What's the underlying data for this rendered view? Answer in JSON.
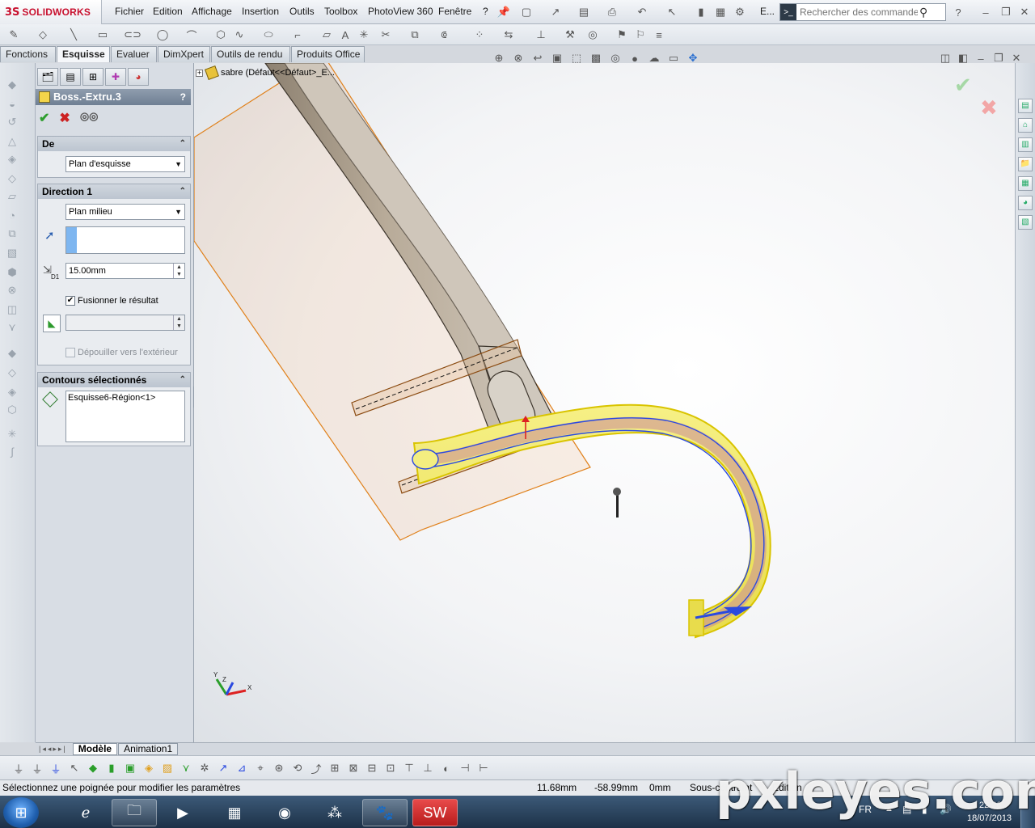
{
  "app": {
    "brand": "SOLIDWORKS",
    "brand_prefix": "3S"
  },
  "menu": {
    "items": [
      "Fichier",
      "Edition",
      "Affichage",
      "Insertion",
      "Outils",
      "Toolbox",
      "PhotoView 360",
      "Fenêtre",
      "?"
    ],
    "extra": "E..."
  },
  "search": {
    "placeholder": "Rechercher des commandes"
  },
  "command_tabs": [
    "Fonctions",
    "Esquisse",
    "Evaluer",
    "DimXpert",
    "Outils de rendu",
    "Produits Office"
  ],
  "active_tab": "Esquisse",
  "feature_tree": {
    "root_label": "sabre  (Défaut<<Défaut>_E..."
  },
  "property_manager": {
    "title": "Boss.-Extru.3",
    "help": "?",
    "groups": {
      "from": {
        "title": "De",
        "start_condition": "Plan d'esquisse"
      },
      "direction1": {
        "title": "Direction 1",
        "end_condition": "Plan milieu",
        "direction_value": "",
        "depth": "15.00mm",
        "depth_label": "D1",
        "merge_result": "Fusionner le résultat",
        "merge_checked": true,
        "draft_value": "",
        "draft_outward": "Dépouiller vers l'extérieur",
        "draft_checked": false
      },
      "contours": {
        "title": "Contours sélectionnés",
        "items": [
          "Esquisse6-Région<1>"
        ]
      }
    }
  },
  "triad": {
    "x": "X",
    "y": "Y",
    "z": "Z"
  },
  "model_tabs": [
    "Modèle",
    "Animation1"
  ],
  "active_model_tab": "Modèle",
  "status": {
    "message": "Sélectionnez une poignée pour modifier les paramètres",
    "x": "11.68mm",
    "y": "-58.99mm",
    "z": "0mm",
    "state": "Sous-contraint",
    "edit": "Edition"
  },
  "tray": {
    "lang": "FR",
    "time": "22:26",
    "date": "18/07/2013"
  },
  "watermark": "pxleyes.com",
  "colors": {
    "brand_red": "#c8102e",
    "accept_green": "#2e9e2e",
    "cancel_red": "#cc2222",
    "preview_yellow": "#f7f07a",
    "sketch_blue": "#2a49e0",
    "outline_orange": "#e0801a"
  }
}
